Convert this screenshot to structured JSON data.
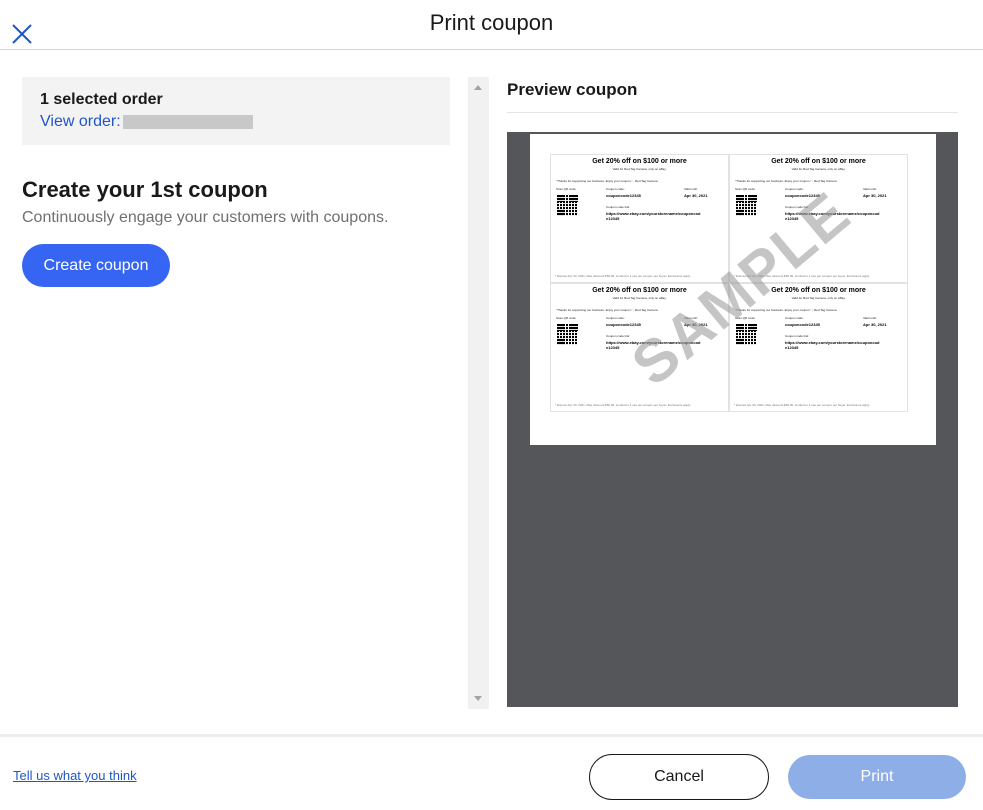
{
  "header": {
    "title": "Print coupon",
    "close_icon": "close-icon"
  },
  "order": {
    "title": "1 selected order",
    "link_label": "View order:"
  },
  "create": {
    "title": "Create your 1st coupon",
    "subtitle": "Continuously engage your customers with coupons.",
    "button_label": "Create coupon"
  },
  "preview": {
    "title": "Preview coupon",
    "watermark": "SAMPLE",
    "coupons": [
      {
        "headline": "Get 20% off on $100 or more",
        "sub": "Valid for Red Tag Camera, only on eBay.",
        "thanks": "\"Thanks for supporting our business. Enjoy your coupon.\" - Red Tag Camera",
        "scan_label": "Scan QR code:",
        "code_label": "Coupon code:",
        "code": "couponcode12345",
        "valid_label": "Valid until:",
        "valid": "Apr 30, 2021",
        "link_label": "Coupon code link:",
        "link": "https://www.ebay.com/yourstorename/couponcode12345",
        "footer": "* Expires Apr 30, 2021. Max discount $50.00. Limited to 1 use per coupon per buyer. Exclusions apply."
      },
      {
        "headline": "Get 20% off on $100 or more",
        "sub": "Valid for Red Tag Camera, only on eBay.",
        "thanks": "\"Thanks for supporting our business. Enjoy your coupon.\" - Red Tag Camera",
        "scan_label": "Scan QR code:",
        "code_label": "Coupon code:",
        "code": "couponcode12345",
        "valid_label": "Valid until:",
        "valid": "Apr 30, 2021",
        "link_label": "Coupon code link:",
        "link": "https://www.ebay.com/yourstorename/couponcode12345",
        "footer": "* Expires Apr 30, 2021. Max discount $50.00. Limited to 1 use per coupon per buyer. Exclusions apply."
      },
      {
        "headline": "Get 20% off on $100 or more",
        "sub": "Valid for Red Tag Camera, only on eBay.",
        "thanks": "\"Thanks for supporting our business. Enjoy your coupon.\" - Red Tag Camera",
        "scan_label": "Scan QR code:",
        "code_label": "Coupon code:",
        "code": "couponcode12345",
        "valid_label": "Valid until:",
        "valid": "Apr 30, 2021",
        "link_label": "Coupon code link:",
        "link": "https://www.ebay.com/yourstorename/couponcode12345",
        "footer": "* Expires Apr 30, 2021. Max discount $50.00. Limited to 1 use per coupon per buyer. Exclusions apply."
      },
      {
        "headline": "Get 20% off on $100 or more",
        "sub": "Valid for Red Tag Camera, only on eBay.",
        "thanks": "\"Thanks for supporting our business. Enjoy your coupon.\" - Red Tag Camera",
        "scan_label": "Scan QR code:",
        "code_label": "Coupon code:",
        "code": "couponcode12345",
        "valid_label": "Valid until:",
        "valid": "Apr 30, 2021",
        "link_label": "Coupon code link:",
        "link": "https://www.ebay.com/yourstorename/couponcode12345",
        "footer": "* Expires Apr 30, 2021. Max discount $50.00. Limited to 1 use per coupon per buyer. Exclusions apply."
      }
    ]
  },
  "footer": {
    "feedback_label": "Tell us what you think",
    "cancel_label": "Cancel",
    "print_label": "Print"
  },
  "colors": {
    "accent": "#3665f3",
    "link": "#1f56c6",
    "print_disabled": "#8daee6",
    "preview_background": "#545659"
  }
}
